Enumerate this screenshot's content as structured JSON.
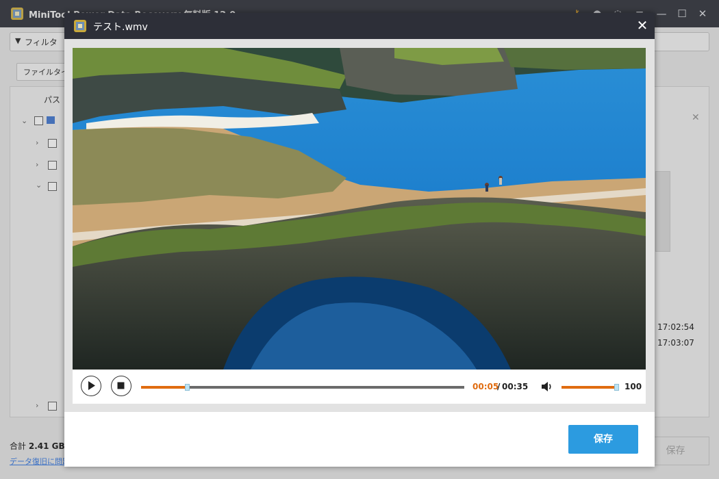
{
  "app": {
    "title": "MiniTool Power Data Recovery 無料版 12.0",
    "toolbar_icons": [
      "key-icon",
      "user-icon",
      "help-icon",
      "menu-icon",
      "minimize-icon",
      "maximize-icon",
      "close-icon"
    ]
  },
  "background": {
    "filter_label": "フィルタ",
    "file_type_label": "ファイルタイプ",
    "path_header": "パス",
    "times": [
      "17:02:54",
      "17:03:07"
    ],
    "total_label": "合計",
    "total_value": "2.41 GB /",
    "help_link": "データ復旧に問題",
    "save_label": "保存"
  },
  "dialog": {
    "title": "テスト.wmv",
    "player": {
      "current_time": "00:05",
      "separator": "/",
      "total_time": "00:35",
      "progress_fraction": 0.143,
      "volume": "100",
      "volume_fraction": 1.0
    },
    "save_label": "保存"
  },
  "colors": {
    "accent": "#e06c10",
    "primary": "#2c9be0",
    "titlebar": "#2d2f38"
  }
}
